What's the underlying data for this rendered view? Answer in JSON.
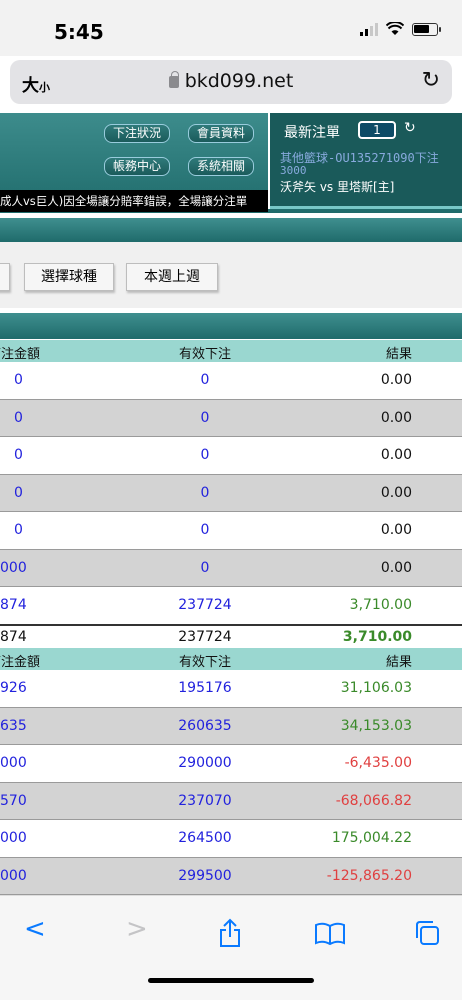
{
  "status": {
    "time": "5:45"
  },
  "browser": {
    "text_size": "大",
    "text_size_small": "小",
    "host": "bkd099.net"
  },
  "header": {
    "buttons": [
      "下注狀況",
      "會員資料",
      "帳務中心",
      "系統相關"
    ],
    "marquee": "成人vs巨人)因全場讓分賠率錯誤，全場讓分注單"
  },
  "latest": {
    "title": "最新注單",
    "count": "1",
    "line1": "其他籃球-OU135271090下注",
    "line2": "3000",
    "line3": "沃斧矢 vs 里塔斯[主]"
  },
  "toolbar": {
    "sport_button": "選擇球種",
    "week_button": "本週上週"
  },
  "table1": {
    "headers": [
      "下注金額",
      "有效下注",
      "結果"
    ],
    "rows": [
      {
        "amount": "0",
        "valid": "0",
        "result": "0.00"
      },
      {
        "amount": "0",
        "valid": "0",
        "result": "0.00"
      },
      {
        "amount": "0",
        "valid": "0",
        "result": "0.00"
      },
      {
        "amount": "0",
        "valid": "0",
        "result": "0.00"
      },
      {
        "amount": "0",
        "valid": "0",
        "result": "0.00"
      },
      {
        "amount": "000",
        "valid": "0",
        "result": "0.00"
      },
      {
        "amount": "874",
        "valid": "237724",
        "result": "3,710.00"
      }
    ],
    "total": {
      "amount": "874",
      "valid": "237724",
      "result": "3,710.00"
    }
  },
  "table2": {
    "headers": [
      "下注金額",
      "有效下注",
      "結果"
    ],
    "rows": [
      {
        "amount": "926",
        "valid": "195176",
        "result": "31,106.03"
      },
      {
        "amount": "635",
        "valid": "260635",
        "result": "34,153.03"
      },
      {
        "amount": "000",
        "valid": "290000",
        "result": "-6,435.00"
      },
      {
        "amount": "570",
        "valid": "237070",
        "result": "-68,066.82"
      },
      {
        "amount": "000",
        "valid": "264500",
        "result": "175,004.22"
      },
      {
        "amount": "000",
        "valid": "299500",
        "result": "-125,865.20"
      }
    ]
  },
  "colors": {
    "header_teal": "#1f6b6b",
    "table_header": "#9ad7d0",
    "positive": "#3a8a2a",
    "negative": "#e04040",
    "link_blue": "#2222dd"
  }
}
